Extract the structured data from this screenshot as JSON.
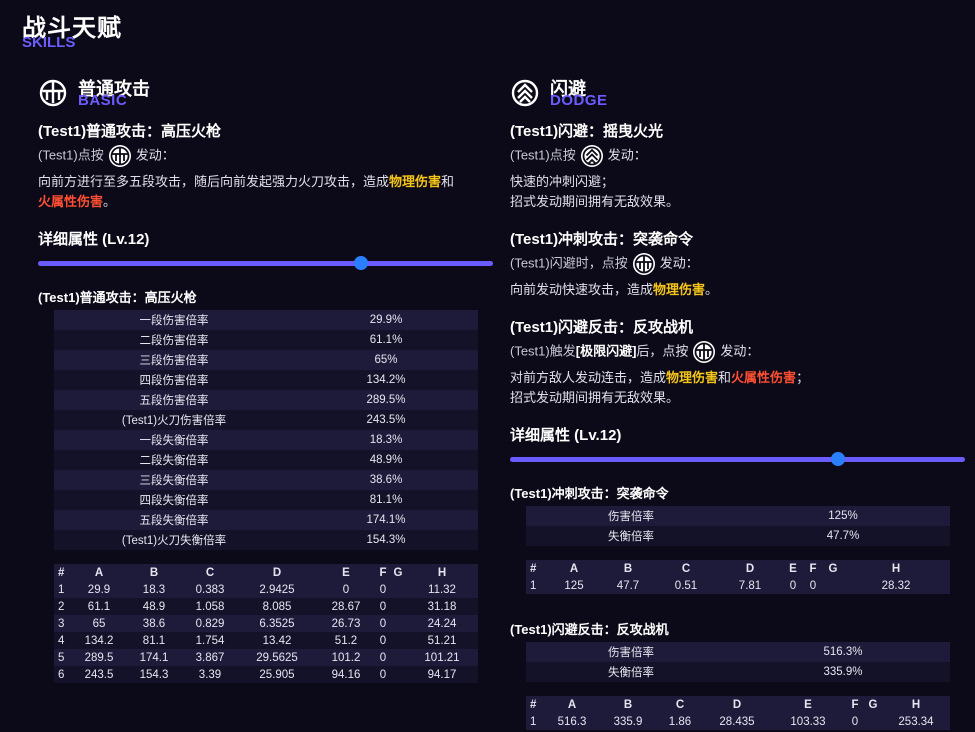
{
  "header": {
    "title": "战斗天赋",
    "subtitle": "SKILLS"
  },
  "basic": {
    "title": "普通攻击",
    "subtitle": "BASIC",
    "skill_name": "(Test1)普通攻击：高压火枪",
    "trigger_prefix": "(Test1)点按",
    "trigger_suffix": "发动：",
    "desc_1": "向前方进行至多五段攻击，随后向前发起强力火刀攻击，造成",
    "desc_phys": "物理伤害",
    "desc_and": "和",
    "desc_fire": "火属性伤害",
    "desc_end": "。",
    "detail_label": "详细属性 (Lv.12)",
    "slider_value": 0.71,
    "table_title": "(Test1)普通攻击：高压火枪",
    "attrs": [
      [
        "一段伤害倍率",
        "29.9%"
      ],
      [
        "二段伤害倍率",
        "61.1%"
      ],
      [
        "三段伤害倍率",
        "65%"
      ],
      [
        "四段伤害倍率",
        "134.2%"
      ],
      [
        "五段伤害倍率",
        "289.5%"
      ],
      [
        "(Test1)火刀伤害倍率",
        "243.5%"
      ],
      [
        "一段失衡倍率",
        "18.3%"
      ],
      [
        "二段失衡倍率",
        "48.9%"
      ],
      [
        "三段失衡倍率",
        "38.6%"
      ],
      [
        "四段失衡倍率",
        "81.1%"
      ],
      [
        "五段失衡倍率",
        "174.1%"
      ],
      [
        "(Test1)火刀失衡倍率",
        "154.3%"
      ]
    ],
    "data_headers": [
      "#",
      "A",
      "B",
      "C",
      "D",
      "E",
      "F",
      "G",
      "H"
    ],
    "data_rows": [
      [
        "1",
        "29.9",
        "18.3",
        "0.383",
        "2.9425",
        "0",
        "0",
        "",
        "11.32"
      ],
      [
        "2",
        "61.1",
        "48.9",
        "1.058",
        "8.085",
        "28.67",
        "0",
        "",
        "31.18"
      ],
      [
        "3",
        "65",
        "38.6",
        "0.829",
        "6.3525",
        "26.73",
        "0",
        "",
        "24.24"
      ],
      [
        "4",
        "134.2",
        "81.1",
        "1.754",
        "13.42",
        "51.2",
        "0",
        "",
        "51.21"
      ],
      [
        "5",
        "289.5",
        "174.1",
        "3.867",
        "29.5625",
        "101.2",
        "0",
        "",
        "101.21"
      ],
      [
        "6",
        "243.5",
        "154.3",
        "3.39",
        "25.905",
        "94.16",
        "0",
        "",
        "94.17"
      ]
    ]
  },
  "dodge": {
    "title": "闪避",
    "subtitle": "DODGE",
    "s1_name": "(Test1)闪避：摇曳火光",
    "s1_trigger_prefix": "(Test1)点按",
    "s1_trigger_suffix": "发动：",
    "s1_desc_1": "快速的冲刺闪避；",
    "s1_desc_2": "招式发动期间拥有无敌效果。",
    "s2_name": "(Test1)冲刺攻击：突袭命令",
    "s2_trigger_prefix": "(Test1)闪避时，点按",
    "s2_trigger_suffix": "发动：",
    "s2_desc_1": "向前发动快速攻击，造成",
    "s2_desc_phys": "物理伤害",
    "s2_desc_end": "。",
    "s3_name": "(Test1)闪避反击：反攻战机",
    "s3_trigger_prefix": "(Test1)触发",
    "s3_trigger_bold": "[极限闪避]",
    "s3_trigger_mid": "后，点按",
    "s3_trigger_suffix": "发动：",
    "s3_desc_1": "对前方敌人发动连击，造成",
    "s3_desc_phys": "物理伤害",
    "s3_desc_and": "和",
    "s3_desc_fire": "火属性伤害",
    "s3_desc_end": "；",
    "s3_desc_2": "招式发动期间拥有无敌效果。",
    "detail_label": "详细属性 (Lv.12)",
    "slider_value": 0.72,
    "t1_title": "(Test1)冲刺攻击：突袭命令",
    "t1_attrs": [
      [
        "伤害倍率",
        "125%"
      ],
      [
        "失衡倍率",
        "47.7%"
      ]
    ],
    "t1_headers": [
      "#",
      "A",
      "B",
      "C",
      "D",
      "E",
      "F",
      "G",
      "H"
    ],
    "t1_rows": [
      [
        "1",
        "125",
        "47.7",
        "0.51",
        "7.81",
        "0",
        "0",
        "",
        "28.32"
      ]
    ],
    "t2_title": "(Test1)闪避反击：反攻战机",
    "t2_attrs": [
      [
        "伤害倍率",
        "516.3%"
      ],
      [
        "失衡倍率",
        "335.9%"
      ]
    ],
    "t2_headers": [
      "#",
      "A",
      "B",
      "C",
      "D",
      "E",
      "F",
      "G",
      "H"
    ],
    "t2_rows": [
      [
        "1",
        "516.3",
        "335.9",
        "1.86",
        "28.435",
        "103.33",
        "0",
        "",
        "253.34"
      ]
    ]
  }
}
